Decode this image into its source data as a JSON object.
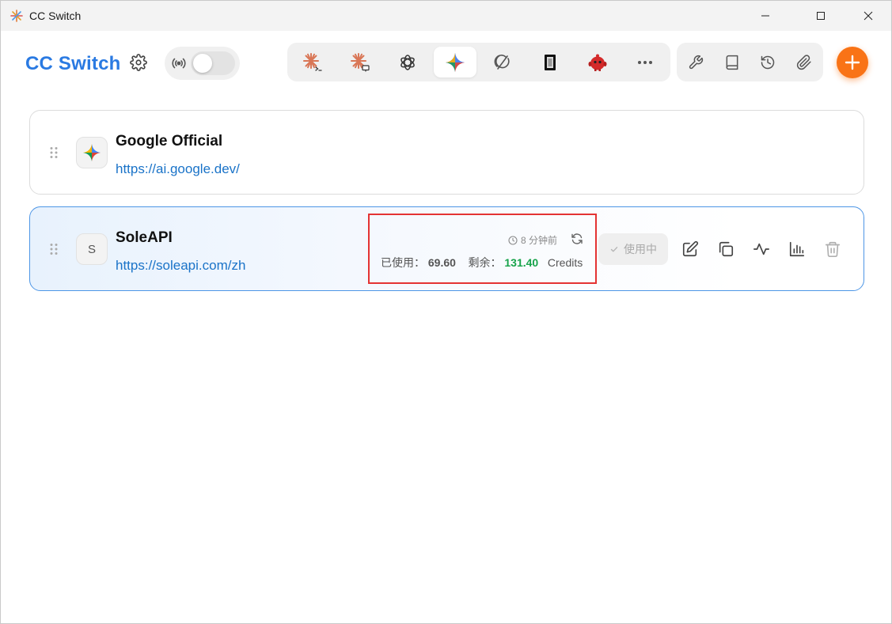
{
  "window": {
    "title": "CC Switch"
  },
  "header": {
    "brand": "CC Switch",
    "app_tabs": [
      {
        "name": "claude-code-icon",
        "active": false
      },
      {
        "name": "claude-desktop-icon",
        "active": false
      },
      {
        "name": "openai-icon",
        "active": false
      },
      {
        "name": "gemini-icon",
        "active": true
      },
      {
        "name": "opencode-icon",
        "active": false
      },
      {
        "name": "terminal-app-icon",
        "active": false
      },
      {
        "name": "red-bot-icon",
        "active": false
      },
      {
        "name": "more-icon",
        "active": false
      }
    ],
    "tools": [
      "wrench-icon",
      "book-icon",
      "history-icon",
      "paperclip-icon"
    ],
    "accent": "#f97316",
    "brand_color": "#2a7ae2"
  },
  "providers": [
    {
      "name": "Google Official",
      "url": "https://ai.google.dev/",
      "avatar": "gemini-icon",
      "active": false
    },
    {
      "name": "SoleAPI",
      "url": "https://soleapi.com/zh",
      "avatar_letter": "S",
      "active": true,
      "usage": {
        "time_ago": "8 分钟前",
        "used_label": "已使用：",
        "used_value": "69.60",
        "remain_label": "剩余：",
        "remain_value": "131.40",
        "unit": "Credits"
      },
      "status_button": "使用中"
    }
  ]
}
